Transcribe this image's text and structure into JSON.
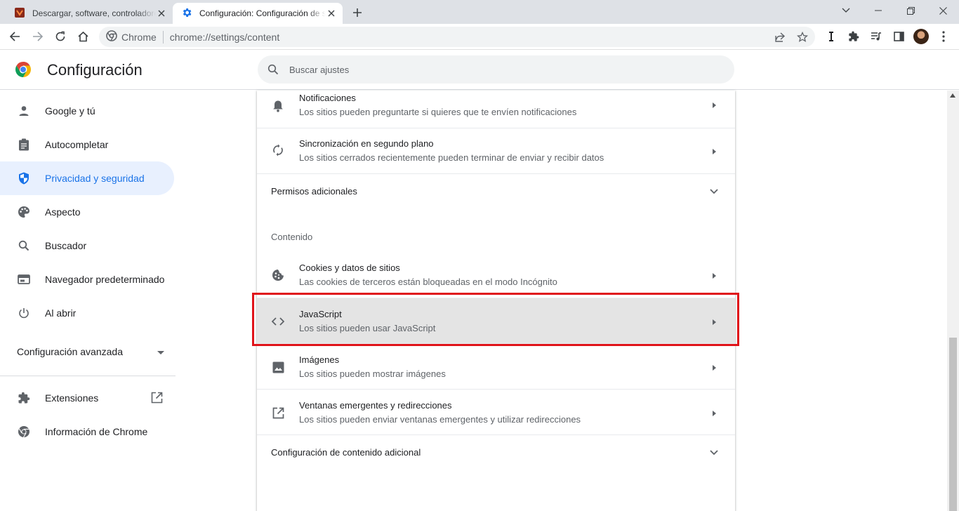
{
  "tabs": [
    {
      "title": "Descargar, software, controladores",
      "icon": "site-favicon"
    },
    {
      "title": "Configuración: Configuración de sitios",
      "icon": "gear-icon"
    }
  ],
  "toolbar": {
    "site_label": "Chrome",
    "url": "chrome://settings/content"
  },
  "header": {
    "title": "Configuración",
    "search_placeholder": "Buscar ajustes"
  },
  "sidebar": {
    "items": [
      {
        "label": "Google y tú",
        "icon": "person-icon"
      },
      {
        "label": "Autocompletar",
        "icon": "clipboard-icon"
      },
      {
        "label": "Privacidad y seguridad",
        "icon": "shield-icon",
        "active": true
      },
      {
        "label": "Aspecto",
        "icon": "palette-icon"
      },
      {
        "label": "Buscador",
        "icon": "search-icon"
      },
      {
        "label": "Navegador predeterminado",
        "icon": "browser-icon"
      },
      {
        "label": "Al abrir",
        "icon": "power-icon"
      }
    ],
    "advanced": "Configuración avanzada",
    "extensions": "Extensiones",
    "about": "Información de Chrome"
  },
  "main": {
    "notifications": {
      "title": "Notificaciones",
      "desc": "Los sitios pueden preguntarte si quieres que te envíen notificaciones"
    },
    "background_sync": {
      "title": "Sincronización en segundo plano",
      "desc": "Los sitios cerrados recientemente pueden terminar de enviar y recibir datos"
    },
    "additional_permissions": "Permisos adicionales",
    "content_heading": "Contenido",
    "cookies": {
      "title": "Cookies y datos de sitios",
      "desc": "Las cookies de terceros están bloqueadas en el modo Incógnito"
    },
    "javascript": {
      "title": "JavaScript",
      "desc": "Los sitios pueden usar JavaScript"
    },
    "images": {
      "title": "Imágenes",
      "desc": "Los sitios pueden mostrar imágenes"
    },
    "popups": {
      "title": "Ventanas emergentes y redirecciones",
      "desc": "Los sitios pueden enviar ventanas emergentes y utilizar redirecciones"
    },
    "additional_content": "Configuración de contenido adicional"
  },
  "colors": {
    "accent": "#1a73e8",
    "highlight_border": "#e0131a",
    "active_bg": "#e8f0fe"
  }
}
